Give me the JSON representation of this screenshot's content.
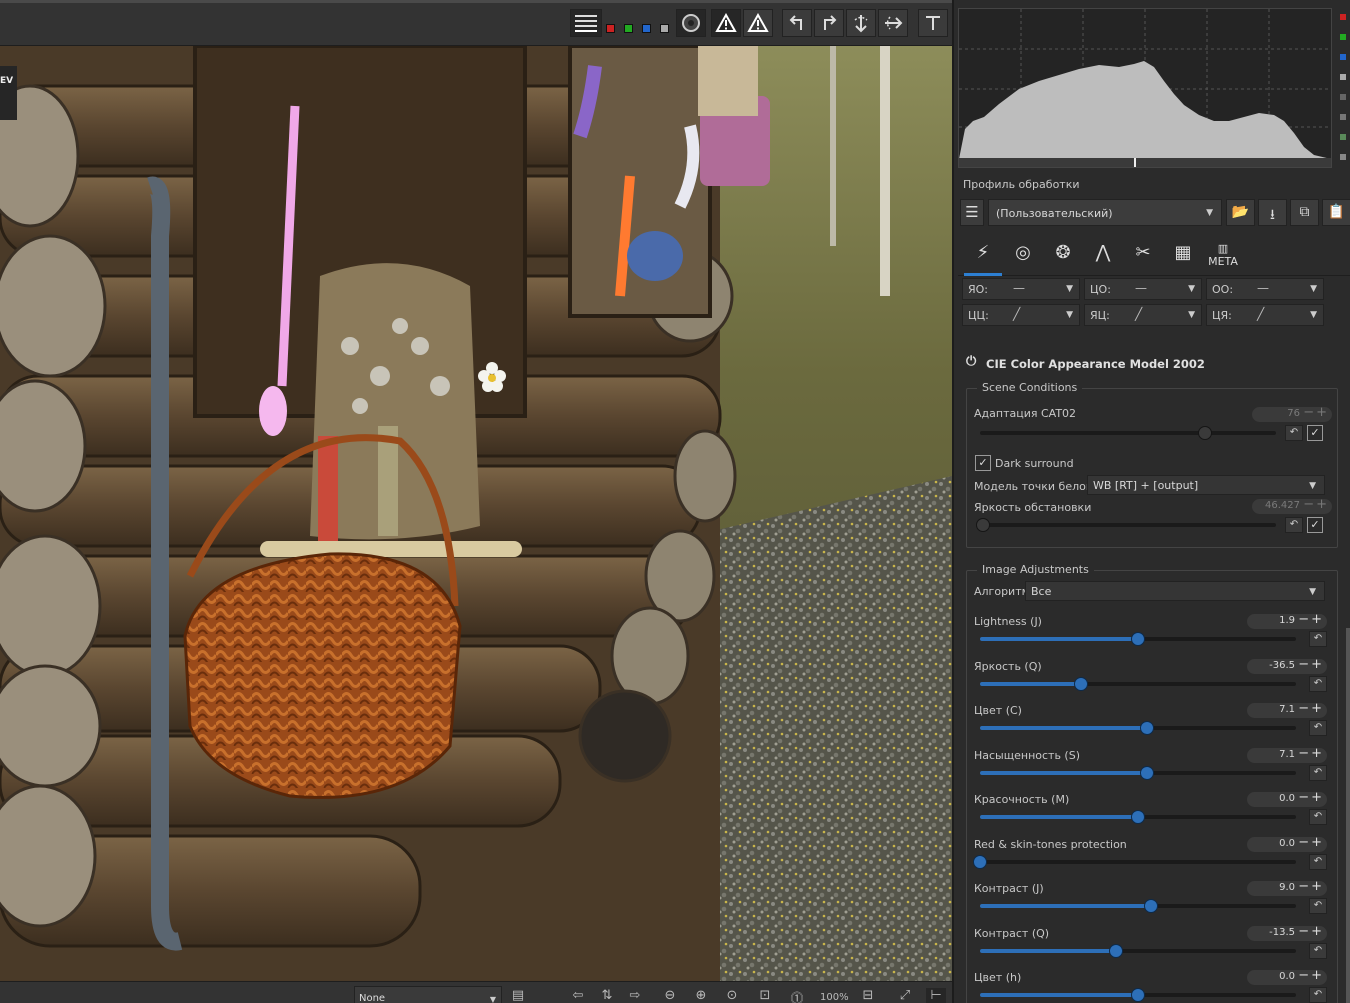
{
  "toolbar": {
    "swatch_colors": [
      "#cc2222",
      "#22aa22",
      "#2266cc",
      "#aaaaaa"
    ]
  },
  "viewport": {
    "ev_badge": "EV"
  },
  "bottom_bar": {
    "preview_mode": "None",
    "zoom": "100%"
  },
  "right_panel": {
    "profile_label": "Профиль обработки",
    "profile_value": "(Пользовательский)",
    "curve_modes": [
      {
        "label": "ЯО:",
        "symbol": "—"
      },
      {
        "label": "ЦО:",
        "symbol": "—"
      },
      {
        "label": "ОО:",
        "symbol": "—"
      },
      {
        "label": "ЦЦ:",
        "symbol": "╱"
      },
      {
        "label": "ЯЦ:",
        "symbol": "╱"
      },
      {
        "label": "ЦЯ:",
        "symbol": "╱"
      }
    ],
    "ciecam": {
      "title": "CIE Color Appearance Model 2002",
      "scene": {
        "title": "Scene Conditions",
        "adaptation_label": "Адаптация CAT02",
        "adaptation_value": "76",
        "dark_surround_label": "Dark surround",
        "white_model_label": "Модель точки белого:",
        "white_model_value": "WB [RT] + [output]",
        "luminance_label": "Яркость обстановки",
        "luminance_value": "46.427"
      },
      "adjustments": {
        "title": "Image Adjustments",
        "algorithm_label": "Алгоритм:",
        "algorithm_value": "Все",
        "sliders": [
          {
            "label": "Lightness (J)",
            "value": "1.9",
            "fraction": 0.5
          },
          {
            "label": "Яркость (Q)",
            "value": "-36.5",
            "fraction": 0.32
          },
          {
            "label": "Цвет (C)",
            "value": "7.1",
            "fraction": 0.53
          },
          {
            "label": "Насыщенность (S)",
            "value": "7.1",
            "fraction": 0.53
          },
          {
            "label": "Красочность (M)",
            "value": "0.0",
            "fraction": 0.5
          },
          {
            "label": "Red & skin-tones protection",
            "value": "0.0",
            "fraction": 0.0
          },
          {
            "label": "Контраст (J)",
            "value": "9.0",
            "fraction": 0.54
          },
          {
            "label": "Контраст (Q)",
            "value": "-13.5",
            "fraction": 0.43
          },
          {
            "label": "Цвет (h)",
            "value": "0.0",
            "fraction": 0.5
          }
        ]
      }
    }
  }
}
